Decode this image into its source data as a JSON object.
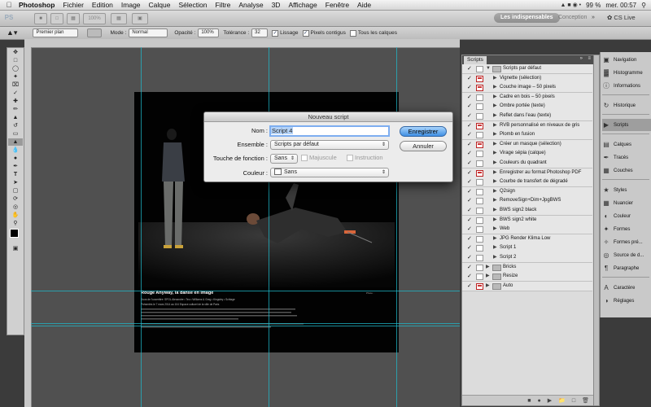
{
  "menubar": {
    "app": "Photoshop",
    "items": [
      "Fichier",
      "Edition",
      "Image",
      "Calque",
      "Sélection",
      "Filtre",
      "Analyse",
      "3D",
      "Affichage",
      "Fenêtre",
      "Aide"
    ],
    "battery": "99 %",
    "clock": "mer. 00:57"
  },
  "appbar": {
    "ps_label": "PS",
    "zoom": "100%",
    "workspace_active": "Les indispensables",
    "workspace_other": "Conception",
    "cs_live": "CS Live"
  },
  "options": {
    "fill_source": "Premier plan",
    "mode_label": "Mode :",
    "mode_value": "Normal",
    "opacity_label": "Opacité :",
    "opacity_value": "100%",
    "tolerance_label": "Tolérance :",
    "tolerance_value": "32",
    "antialias_label": "Lissage",
    "contiguous_label": "Pixels contigus",
    "all_layers_label": "Tous les calques"
  },
  "document": {
    "caption_title": "Rouge Anyway, la danse en image",
    "caption_credit": "Photo : ",
    "caption_body_1": "Duos de l'ouvertitre: SPOL Alexandre • Teo • Williams & Greg • Kingsley • Schlage",
    "caption_body_2": "Présentés le 7 mars 2014 au 104 Espace culturel de la ville de Paris"
  },
  "dialog": {
    "title": "Nouveau script",
    "name_label": "Nom :",
    "name_value": "Script 4",
    "set_label": "Ensemble :",
    "set_value": "Scripts par défaut",
    "fkey_label": "Touche de fonction :",
    "fkey_value": "Sans",
    "shift_label": "Majuscule",
    "cmd_label": "Instruction",
    "color_label": "Couleur :",
    "color_value": "Sans",
    "record_button": "Enregistrer",
    "cancel_button": "Annuler"
  },
  "scripts_panel": {
    "tab": "Scripts",
    "rows": [
      {
        "label": "Scripts par défaut",
        "type": "folder-open",
        "dialog": false
      },
      {
        "label": "Vignette (sélection)",
        "type": "item",
        "dialog": true
      },
      {
        "label": "Couche image – 50 pixels",
        "type": "item",
        "dialog": true
      },
      {
        "label": "Cadre en bois – 50 pixels",
        "type": "item",
        "dialog": false
      },
      {
        "label": "Ombre portée (texte)",
        "type": "item",
        "dialog": false
      },
      {
        "label": "Reflet dans l'eau (texte)",
        "type": "item",
        "dialog": false
      },
      {
        "label": "RVB personnalisé en niveaux de gris",
        "type": "item",
        "dialog": true
      },
      {
        "label": "Plomb en fusion",
        "type": "item",
        "dialog": false
      },
      {
        "label": "Créer un masque (sélection)",
        "type": "item",
        "dialog": true
      },
      {
        "label": "Virage sépia (calque)",
        "type": "item",
        "dialog": false
      },
      {
        "label": "Couleurs du quadrant",
        "type": "item",
        "dialog": false
      },
      {
        "label": "Enregistrer au format Photoshop PDF",
        "type": "item",
        "dialog": true
      },
      {
        "label": "Courbe de transfert de dégradé",
        "type": "item",
        "dialog": false
      },
      {
        "label": "Q2sign",
        "type": "item",
        "dialog": false
      },
      {
        "label": "RemoveSign+Dim+JpgBWS",
        "type": "item",
        "dialog": false
      },
      {
        "label": "BWS sign2 black",
        "type": "item",
        "dialog": false
      },
      {
        "label": "BWS sign2 white",
        "type": "item",
        "dialog": false
      },
      {
        "label": "Web",
        "type": "item",
        "dialog": false
      },
      {
        "label": "JPG Render Klima Low",
        "type": "item",
        "dialog": false
      },
      {
        "label": "Script 1",
        "type": "item",
        "dialog": false
      },
      {
        "label": "Script 2",
        "type": "item",
        "dialog": false
      },
      {
        "label": "Bricks",
        "type": "folder",
        "dialog": false
      },
      {
        "label": "Resize",
        "type": "folder",
        "dialog": false
      },
      {
        "label": "Auto",
        "type": "folder",
        "dialog": true
      }
    ]
  },
  "dock": {
    "items": [
      {
        "label": "Navigation",
        "icon": "navigator-icon"
      },
      {
        "label": "Histogramme",
        "icon": "histogram-icon"
      },
      {
        "label": "Informations",
        "icon": "info-icon"
      },
      {
        "label": "Historique",
        "icon": "history-icon"
      },
      {
        "label": "Scripts",
        "icon": "actions-icon"
      },
      {
        "label": "Calques",
        "icon": "layers-icon"
      },
      {
        "label": "Tracés",
        "icon": "paths-icon"
      },
      {
        "label": "Couches",
        "icon": "channels-icon"
      },
      {
        "label": "Styles",
        "icon": "styles-icon"
      },
      {
        "label": "Nuancier",
        "icon": "swatches-icon"
      },
      {
        "label": "Couleur",
        "icon": "color-icon"
      },
      {
        "label": "Formes",
        "icon": "brushes-icon"
      },
      {
        "label": "Formes pré...",
        "icon": "brush-presets-icon"
      },
      {
        "label": "Source de d...",
        "icon": "clone-source-icon"
      },
      {
        "label": "Paragraphe",
        "icon": "paragraph-icon"
      },
      {
        "label": "Caractère",
        "icon": "character-icon"
      },
      {
        "label": "Réglages",
        "icon": "adjustments-icon"
      }
    ]
  },
  "colors": {
    "guide": "#1fb8c9",
    "default_button": "#3f8fe3",
    "panel_bg": "#dcdcdc"
  }
}
